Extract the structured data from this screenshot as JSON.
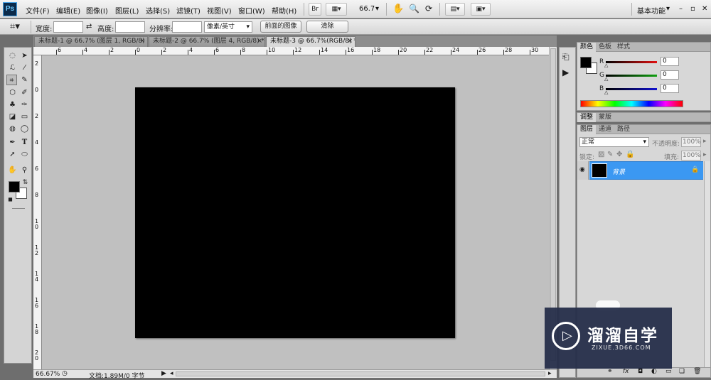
{
  "menubar": {
    "logo": "Ps",
    "items": [
      "文件(F)",
      "编辑(E)",
      "图像(I)",
      "图层(L)",
      "选择(S)",
      "滤镜(T)",
      "视图(V)",
      "窗口(W)",
      "帮助(H)"
    ],
    "br_label": "Br",
    "zoom_value": "66.7",
    "workspace": "基本功能",
    "window_controls": [
      "–",
      "▫",
      "✕"
    ]
  },
  "options": {
    "width_label": "宽度:",
    "height_label": "高度:",
    "resolution_label": "分辨率:",
    "unit_value": "像素/英寸",
    "front_image_button": "前面的图像",
    "clear_button": "清除"
  },
  "tabs": [
    {
      "label": "未标题-1 @ 66.7% (图层 1, RGB/8) *",
      "close": "×"
    },
    {
      "label": "未标题-2 @ 66.7% (图层 4, RGB/8) *",
      "close": "×"
    },
    {
      "label": "未标题-3 @ 66.7%(RGB/8) *",
      "close": "×"
    }
  ],
  "ruler": {
    "top_labels": [
      "6",
      "4",
      "2",
      "0",
      "2",
      "4",
      "6",
      "8",
      "10",
      "12",
      "14",
      "16",
      "18",
      "20",
      "22",
      "24",
      "26",
      "28",
      "30"
    ],
    "left_labels": [
      "2",
      "0",
      "2",
      "4",
      "6",
      "8",
      "1\n0",
      "1\n2",
      "1\n4",
      "1\n6",
      "1\n8",
      "2\n0"
    ]
  },
  "status": {
    "zoom": "66.67%",
    "doc_info": "文档:1.89M/0 字节"
  },
  "color_panel": {
    "tabs": [
      "颜色",
      "色板",
      "样式"
    ],
    "channels": [
      {
        "label": "R",
        "value": "0",
        "color": "#e01010"
      },
      {
        "label": "G",
        "value": "0",
        "color": "#10a010"
      },
      {
        "label": "B",
        "value": "0",
        "color": "#1010d0"
      }
    ]
  },
  "adjust_panel": {
    "tabs": [
      "调整",
      "蒙版"
    ]
  },
  "layers_panel": {
    "tabs": [
      "图层",
      "通道",
      "路径"
    ],
    "blend_mode": "正常",
    "opacity_label": "不透明度:",
    "opacity_value": "100%",
    "lock_label": "锁定:",
    "fill_label": "填充:",
    "fill_value": "100%",
    "layer_name": "背景",
    "footer_fx": "fx"
  },
  "watermark": {
    "title": "溜溜自学",
    "url": "ZIXUE.3D66.COM"
  },
  "colors": {
    "foreground": "#000000",
    "background": "#ffffff",
    "layer_selected": "#3b98f2",
    "canvas": "#000000"
  }
}
